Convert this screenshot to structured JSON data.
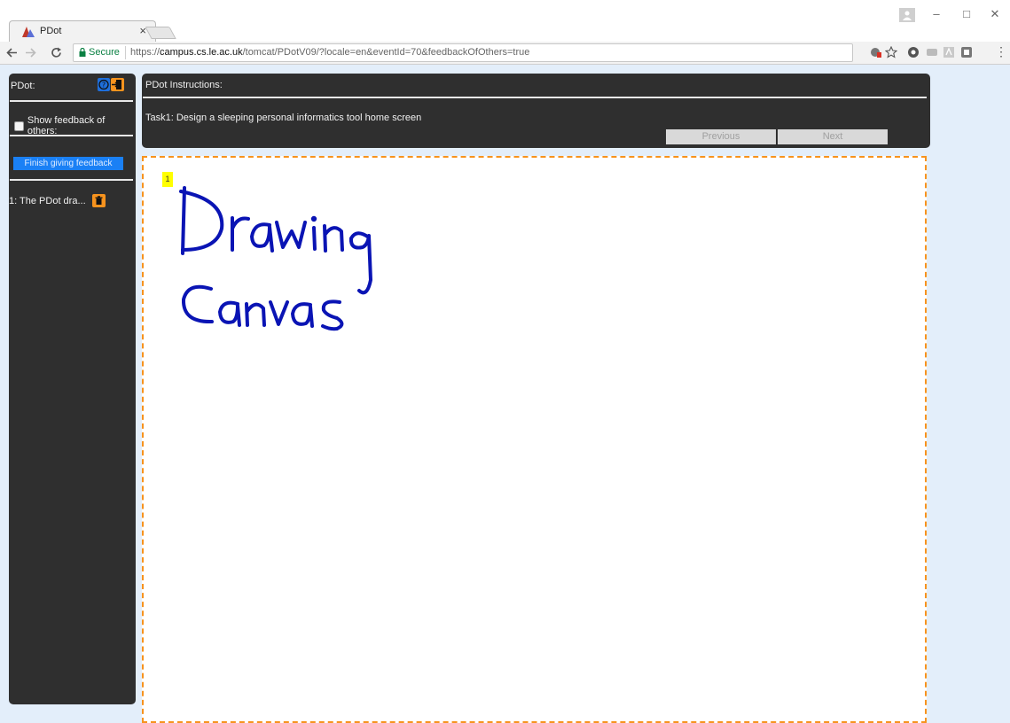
{
  "browser": {
    "tab_title": "PDot",
    "tab_close": "×",
    "secure_label": "Secure",
    "url_prefix": "https://",
    "url_host": "campus.cs.le.ac.uk",
    "url_path": "/tomcat/PDotV09/?locale=en&eventId=70&feedbackOfOthers=true",
    "window_controls": {
      "minimize": "–",
      "maximize": "□",
      "close": "✕"
    },
    "menu_label": "⋮"
  },
  "sidebar": {
    "title": "PDot:",
    "show_feedback_label": "Show feedback of others:",
    "show_feedback_checked": false,
    "finish_button": "Finish giving feedback",
    "drawing_item": "1: The PDot dra..."
  },
  "instructions": {
    "title": "PDot Instructions:",
    "task": "Task1: Design a sleeping personal informatics tool home screen",
    "previous_button": "Previous",
    "next_button": "Next"
  },
  "canvas": {
    "page_number": "1",
    "handwritten_text": "Drawing Canvas",
    "ink_color": "#0a14b4",
    "border_color": "#f7931e"
  },
  "colors": {
    "panel_bg": "#2f2f2f",
    "accent_blue": "#1a80f5",
    "accent_orange": "#f7931e",
    "page_bg": "#e3eefa"
  }
}
